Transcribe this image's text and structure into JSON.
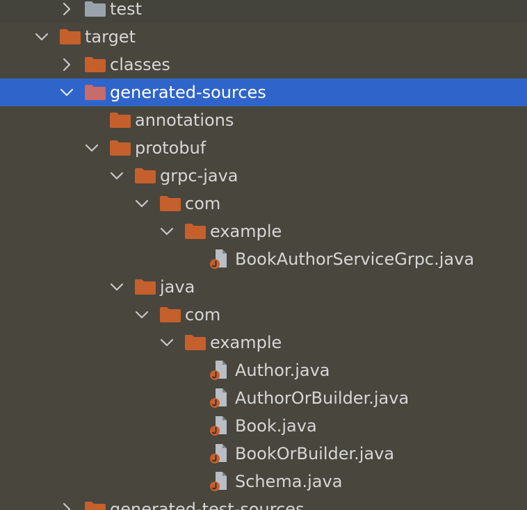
{
  "colors": {
    "background": "#48463d",
    "selection": "#2f65ca",
    "folder": "#c5602d",
    "folder_test": "#9aa3ad",
    "folder_generated": "#c86b6b",
    "text": "#d6d6d6",
    "java_badge": "#c5602d"
  },
  "project_tree": {
    "items": [
      {
        "label": "test",
        "type": "folder",
        "icon": "gray-folder-icon",
        "expanded": false
      },
      {
        "label": "target",
        "type": "folder",
        "icon": "folder-icon",
        "expanded": true
      },
      {
        "label": "classes",
        "type": "folder",
        "icon": "folder-icon",
        "expanded": false
      },
      {
        "label": "generated-sources",
        "type": "folder",
        "icon": "generated-folder-icon",
        "expanded": true,
        "selected": true
      },
      {
        "label": "annotations",
        "type": "folder",
        "icon": "folder-icon",
        "expanded": false
      },
      {
        "label": "protobuf",
        "type": "folder",
        "icon": "folder-icon",
        "expanded": true
      },
      {
        "label": "grpc-java",
        "type": "folder",
        "icon": "folder-icon",
        "expanded": true
      },
      {
        "label": "com",
        "type": "folder",
        "icon": "folder-icon",
        "expanded": true
      },
      {
        "label": "example",
        "type": "folder",
        "icon": "folder-icon",
        "expanded": true
      },
      {
        "label": "BookAuthorServiceGrpc.java",
        "type": "file",
        "icon": "java-file-icon"
      },
      {
        "label": "java",
        "type": "folder",
        "icon": "folder-icon",
        "expanded": true
      },
      {
        "label": "com",
        "type": "folder",
        "icon": "folder-icon",
        "expanded": true
      },
      {
        "label": "example",
        "type": "folder",
        "icon": "folder-icon",
        "expanded": true
      },
      {
        "label": "Author.java",
        "type": "file",
        "icon": "java-file-icon"
      },
      {
        "label": "AuthorOrBuilder.java",
        "type": "file",
        "icon": "java-file-icon"
      },
      {
        "label": "Book.java",
        "type": "file",
        "icon": "java-file-icon"
      },
      {
        "label": "BookOrBuilder.java",
        "type": "file",
        "icon": "java-file-icon"
      },
      {
        "label": "Schema.java",
        "type": "file",
        "icon": "java-file-icon"
      },
      {
        "label": "generated-test-sources",
        "type": "folder",
        "icon": "generated-folder-icon",
        "expanded": false
      }
    ]
  }
}
